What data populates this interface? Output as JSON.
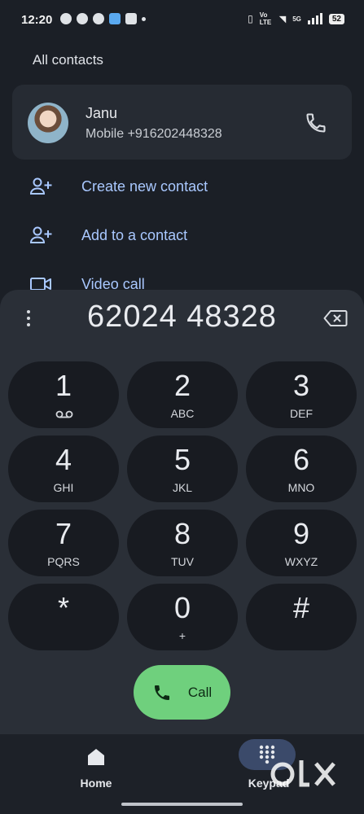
{
  "status_bar": {
    "time": "12:20",
    "network_label_volte": "Vo LTE",
    "network_label_5g": "5G",
    "battery": "52"
  },
  "section_title": "All contacts",
  "contact": {
    "name": "Janu",
    "subtitle": "Mobile +916202448328"
  },
  "actions": [
    {
      "label": "Create new contact",
      "icon": "person-add-icon"
    },
    {
      "label": "Add to a contact",
      "icon": "person-add-icon"
    },
    {
      "label": "Video call",
      "icon": "video-icon"
    }
  ],
  "dialed_number": "62024 48328",
  "keys": [
    {
      "digit": "1",
      "letters": ""
    },
    {
      "digit": "2",
      "letters": "ABC"
    },
    {
      "digit": "3",
      "letters": "DEF"
    },
    {
      "digit": "4",
      "letters": "GHI"
    },
    {
      "digit": "5",
      "letters": "JKL"
    },
    {
      "digit": "6",
      "letters": "MNO"
    },
    {
      "digit": "7",
      "letters": "PQRS"
    },
    {
      "digit": "8",
      "letters": "TUV"
    },
    {
      "digit": "9",
      "letters": "WXYZ"
    },
    {
      "digit": "*",
      "letters": ""
    },
    {
      "digit": "0",
      "letters": "+"
    },
    {
      "digit": "#",
      "letters": ""
    }
  ],
  "call_button": {
    "label": "Call"
  },
  "bottom_nav": {
    "home_label": "Home",
    "keypad_label": "Keypad",
    "selected": "Keypad"
  },
  "colors": {
    "accent_link": "#a9c8ff",
    "call_green": "#6fd07d",
    "background": "#1b1f26"
  }
}
